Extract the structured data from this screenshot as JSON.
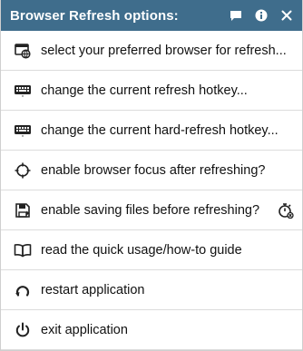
{
  "window": {
    "title": "Browser Refresh options:"
  },
  "titlebar_icons": [
    "chat-icon",
    "info-icon",
    "close-icon"
  ],
  "menu": {
    "items": [
      {
        "label": "select your preferred browser for refresh...",
        "icon": "browser-globe-icon"
      },
      {
        "label": "change the current refresh hotkey...",
        "icon": "keyboard-icon"
      },
      {
        "label": "change the current hard-refresh hotkey...",
        "icon": "keyboard-icon"
      },
      {
        "label": "enable browser focus after refreshing?",
        "icon": "crosshair-icon"
      },
      {
        "label": "enable saving files before refreshing?",
        "icon": "save-icon",
        "extra_icon": "stopwatch-icon"
      },
      {
        "label": "read the quick usage/how-to guide",
        "icon": "book-icon"
      },
      {
        "label": "restart application",
        "icon": "restart-icon"
      },
      {
        "label": "exit application",
        "icon": "power-icon"
      }
    ]
  },
  "colors": {
    "titlebar": "#3f6d8c",
    "title_text": "#ffffff",
    "item_text": "#111111",
    "divider": "#dcdcdc",
    "icon": "#222222"
  }
}
